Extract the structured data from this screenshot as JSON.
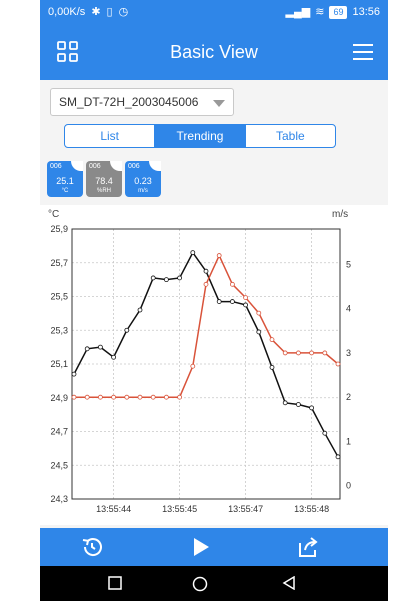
{
  "status_bar": {
    "speed": "0,00K/s",
    "battery": "69",
    "time": "13:56",
    "icons": [
      "bluetooth-icon",
      "vibrate-icon",
      "alarm-icon",
      "signal-icon",
      "wifi-icon",
      "battery-icon"
    ]
  },
  "app_bar": {
    "title": "Basic View",
    "left_icon": "grid-icon",
    "right_icon": "hamburger-menu-icon"
  },
  "device_select": {
    "value": "SM_DT-72H_2003045006"
  },
  "tabs": [
    {
      "label": "List",
      "active": false
    },
    {
      "label": "Trending",
      "active": true
    },
    {
      "label": "Table",
      "active": false
    }
  ],
  "sensors": [
    {
      "id": "006",
      "value": "25.1",
      "unit": "°C",
      "color": "#2f86e8"
    },
    {
      "id": "006",
      "value": "78.4",
      "unit": "%RH",
      "color": "#8a8a8a"
    },
    {
      "id": "006",
      "value": "0.23",
      "unit": "m/s",
      "color": "#2f86e8"
    }
  ],
  "chart_data": {
    "type": "line",
    "left_unit": "°C",
    "right_unit": "m/s",
    "y_left_ticks": [
      "25,9",
      "25,7",
      "25,5",
      "25,3",
      "25,1",
      "24,9",
      "24,7",
      "24,5",
      "24,3"
    ],
    "y_left_range": [
      24.3,
      25.9
    ],
    "y_right_ticks": [
      "5",
      "4",
      "3",
      "2",
      "1",
      "0"
    ],
    "y_right_range": [
      -0.3,
      5.8
    ],
    "x_ticks": [
      {
        "label": "13:55:44",
        "index": 3
      },
      {
        "label": "13:55:45",
        "index": 8
      },
      {
        "label": "13:55:47",
        "index": 13
      },
      {
        "label": "13:55:48",
        "index": 18
      }
    ],
    "x_count": 21,
    "grid": true,
    "series": [
      {
        "axis": "left",
        "color": "#111111",
        "values": [
          25.04,
          25.19,
          25.2,
          25.14,
          25.3,
          25.42,
          25.61,
          25.6,
          25.61,
          25.76,
          25.65,
          25.47,
          25.47,
          25.45,
          25.29,
          25.08,
          24.87,
          24.86,
          24.84,
          24.69,
          24.55
        ]
      },
      {
        "axis": "right",
        "color": "#d9533a",
        "values": [
          2.0,
          2.0,
          2.0,
          2.0,
          2.0,
          2.0,
          2.0,
          2.0,
          2.0,
          2.7,
          4.55,
          5.2,
          4.55,
          4.25,
          3.9,
          3.3,
          3.0,
          3.0,
          3.0,
          3.0,
          2.75
        ]
      }
    ]
  },
  "toolbar": {
    "history_icon": "history-icon",
    "play_icon": "play-icon",
    "share_icon": "share-icon"
  },
  "nav_bar": {
    "recents_icon": "recents-square-icon",
    "home_icon": "home-circle-icon",
    "back_icon": "back-triangle-icon"
  }
}
